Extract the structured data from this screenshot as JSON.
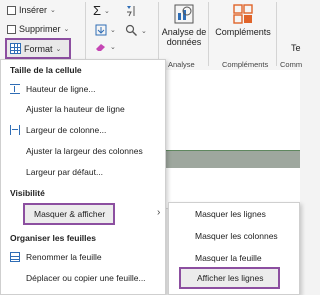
{
  "ribbon": {
    "inserer": "Insérer",
    "supprimer": "Supprimer",
    "format": "Format",
    "sigma": "Σ",
    "analyse_line1": "Analyse de",
    "analyse_line2": "données",
    "analyse_group": "Analyse",
    "complements": "Compléments",
    "complements_group": "Compléments",
    "cut_right_top": "Te",
    "cut_right_bottom": "Comm"
  },
  "menu": {
    "sections": {
      "taille": "Taille de la cellule",
      "visibilite": "Visibilité",
      "organiser": "Organiser les feuilles"
    },
    "items": {
      "hauteur": "Hauteur de ligne...",
      "ajuster_hauteur": "Ajuster la hauteur de ligne",
      "largeur": "Largeur de colonne...",
      "ajuster_largeur": "Ajuster la largeur des colonnes",
      "largeur_defaut": "Largeur par défaut...",
      "masquer": "Masquer & afficher",
      "renommer": "Renommer la feuille",
      "deplacer": "Déplacer ou copier une feuille..."
    }
  },
  "submenu": {
    "items": [
      "Masquer les lignes",
      "Masquer les colonnes",
      "Masquer la feuille",
      "Afficher les lignes"
    ]
  },
  "colors": {
    "highlight": "#8c4fa0",
    "accent": "#2f6db5",
    "selection": "#9ea79e"
  }
}
